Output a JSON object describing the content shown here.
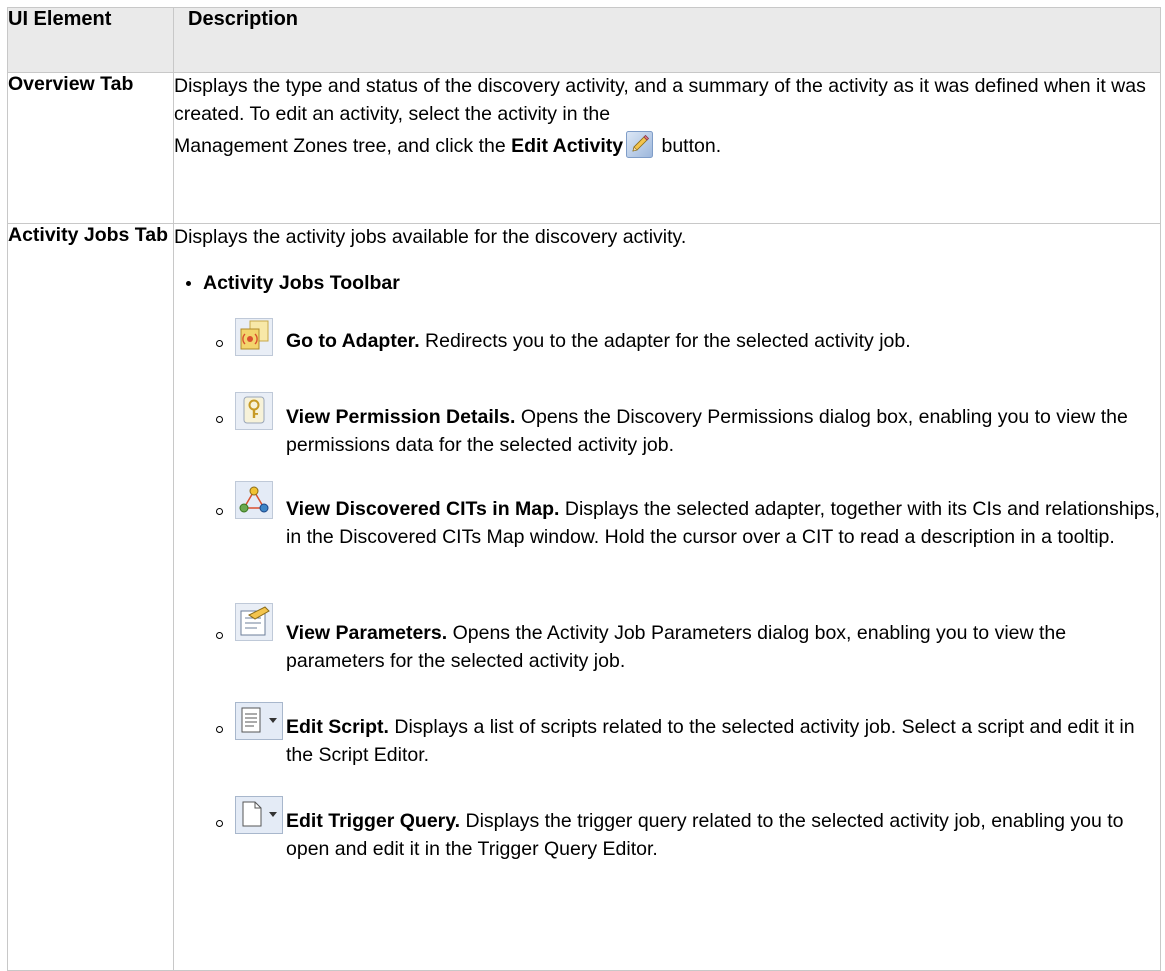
{
  "header": {
    "col1": "UI Element",
    "col2": "Description"
  },
  "rows": [
    {
      "name": "Overview Tab",
      "desc_line1": "Displays the type and status of the discovery activity, and a summary of the activity as it was defined when it was created. To edit an activity, select the activity in the",
      "desc_line2_before": "Management Zones tree, and click the ",
      "desc_line2_bold": "Edit Activity",
      "desc_line2_after": " button.",
      "icon": "pencil-icon"
    },
    {
      "name": "Activity Jobs Tab",
      "intro": "Displays the activity jobs available for the discovery activity.",
      "bullet": "Activity Jobs Toolbar",
      "items": [
        {
          "icon": "go-to-adapter-icon",
          "title": "Go to Adapter.",
          "text": " Redirects you to the adapter for the selected activity job."
        },
        {
          "icon": "view-permission-details-icon",
          "title": "View Permission Details.",
          "text": " Opens the Discovery Permissions dialog box, enabling you to view the permissions data for the selected activity job."
        },
        {
          "icon": "view-discovered-cits-map-icon",
          "title": "View Discovered CITs in Map.",
          "text": " Displays the selected adapter, together with its CIs and relationships, in the Discovered CITs Map window. Hold the cursor over a CIT to read a description in a tooltip."
        },
        {
          "icon": "view-parameters-icon",
          "title": "View Parameters.",
          "text": " Opens the Activity Job Parameters dialog box, enabling you to view the parameters for the selected activity job."
        },
        {
          "icon": "edit-script-icon",
          "title": "Edit Script.",
          "text": " Displays a list of scripts related to the selected activity job. Select a script and edit it in the Script Editor."
        },
        {
          "icon": "edit-trigger-query-icon",
          "title": "Edit Trigger Query.",
          "text": " Displays the trigger query related to the selected activity job, enabling you to open and edit it in the Trigger Query Editor."
        }
      ]
    }
  ]
}
